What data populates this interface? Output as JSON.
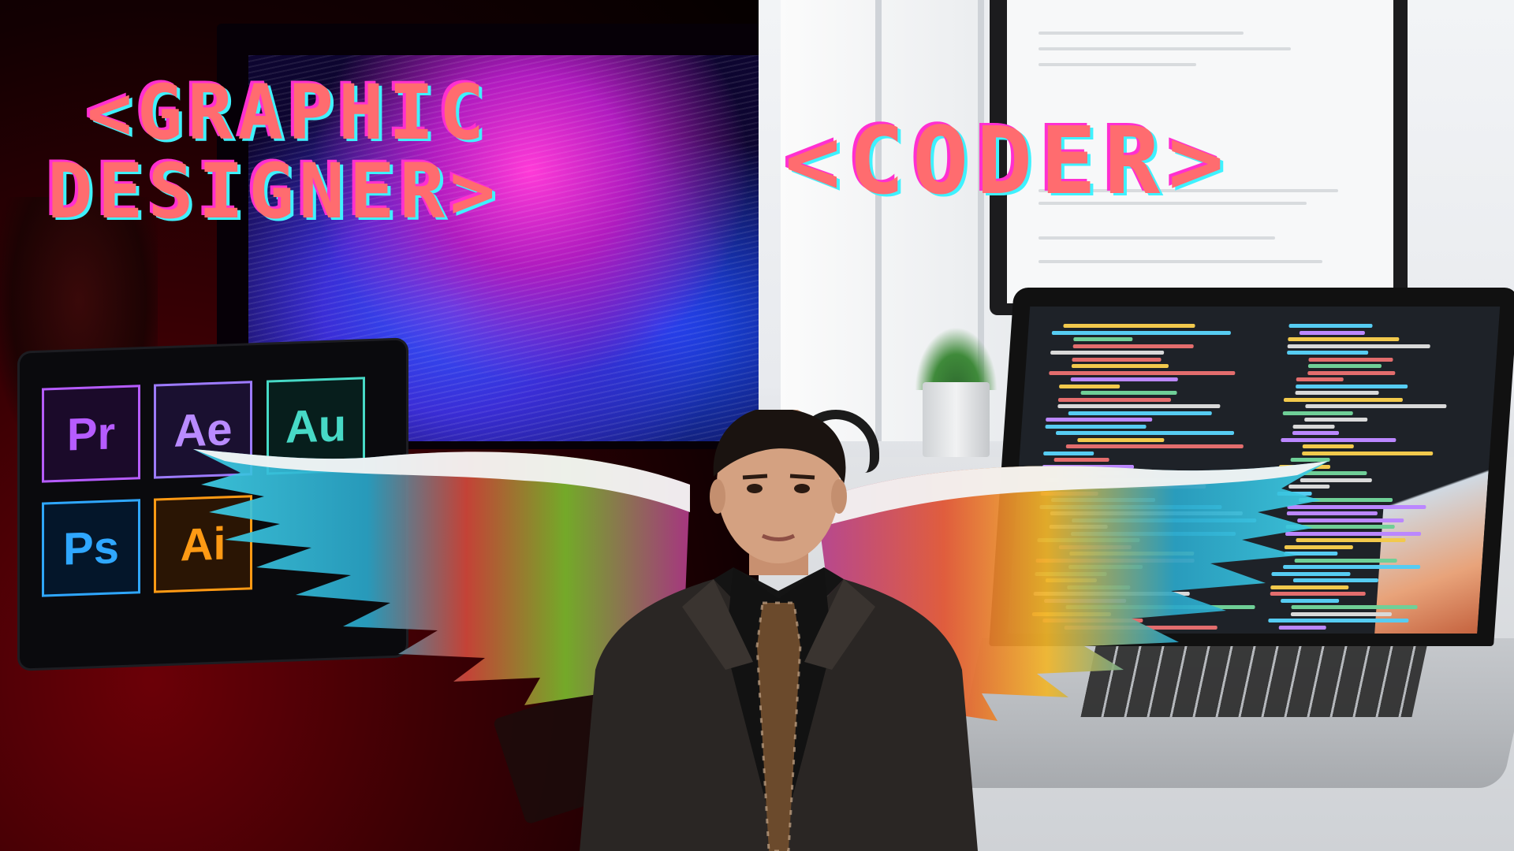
{
  "headline": {
    "line1": "<GRAPHIC",
    "line2": "DESIGNER>",
    "coder": "<CODER>"
  },
  "apps": {
    "pr": "Pr",
    "ae": "Ae",
    "au": "Au",
    "ps": "Ps",
    "ai": "Ai"
  },
  "colors": {
    "headline_fill": "#ff6c6f",
    "headline_glitch_magenta": "#ff2fd0",
    "headline_glitch_cyan": "#3ef2ff",
    "left_background": "#3a0004",
    "right_background": "#e8eaee"
  }
}
